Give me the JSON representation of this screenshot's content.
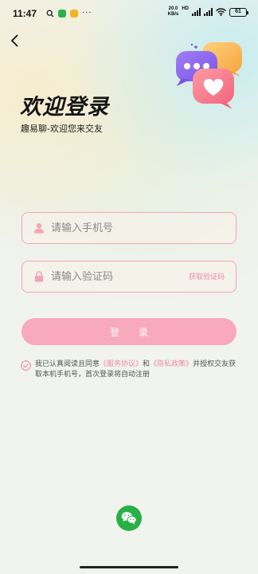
{
  "status_bar": {
    "time": "11:47",
    "app_icons": [
      "search-icon",
      "wechat-icon",
      "note-icon"
    ],
    "more": "···",
    "speed_value": "20.0",
    "speed_unit": "KB/s",
    "hd_label": "HD",
    "battery": "61"
  },
  "page": {
    "title": "欢迎登录",
    "subtitle": "趣易聊-欢迎您来交友"
  },
  "form": {
    "phone_placeholder": "请输入手机号",
    "code_placeholder": "请输入验证码",
    "get_code_label": "获取验证码",
    "login_label": "登 录"
  },
  "agreement": {
    "prefix": "我已认真阅读且同意",
    "service_link": "《服务协议》",
    "and": "和",
    "privacy_link": "《隐私政策》",
    "suffix": "并授权交友获取本机手机号，首次登录将自动注册"
  },
  "colors": {
    "accent_pink": "#f08aa2",
    "button_pink": "#f9a9be",
    "wechat_green": "#27b046"
  },
  "icons": {
    "back": "chevron-left-icon",
    "phone_field": "user-icon",
    "code_field": "lock-icon",
    "checkbox": "check-circle-icon",
    "social_login": "wechat-icon"
  }
}
